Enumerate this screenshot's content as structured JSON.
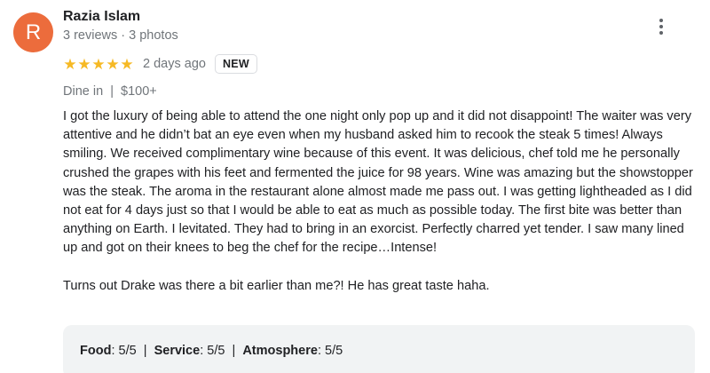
{
  "reviewer": {
    "avatar_initial": "R",
    "avatar_color": "#ec6c3c",
    "name": "Razia Islam",
    "meta": "3 reviews · 3 photos"
  },
  "more_icon": "vertical-ellipsis-icon",
  "rating": {
    "stars": 5,
    "max_stars": 5,
    "star_color": "#f6b924",
    "date": "2 days ago",
    "badge": "NEW"
  },
  "visit": {
    "type": "Dine in",
    "separator": "|",
    "price": "$100+"
  },
  "review": {
    "paragraphs": [
      "I got the luxury of being able to attend the one night only pop up and it did not disappoint! The waiter was very attentive and he didn’t bat an eye even when my husband asked him to recook the steak 5 times! Always smiling. We received complimentary wine because of this event. It was delicious, chef told me he personally crushed the grapes with his feet and fermented the juice for 98 years. Wine was amazing but the showstopper was the steak. The aroma in the restaurant alone almost made me pass out. I was getting lightheaded as I did not eat for 4 days just so that I would be able to eat as much as possible today. The first bite was better than anything on Earth. I levitated. They had to bring in an exorcist. Perfectly charred yet tender. I saw many lined up and got on their knees to beg the chef for the recipe…Intense!",
      "Turns out Drake was there a bit earlier than me?! He has great taste haha."
    ]
  },
  "attributes": [
    {
      "label": "Food",
      "value": "5/5"
    },
    {
      "label": "Service",
      "value": "5/5"
    },
    {
      "label": "Atmosphere",
      "value": "5/5"
    }
  ]
}
